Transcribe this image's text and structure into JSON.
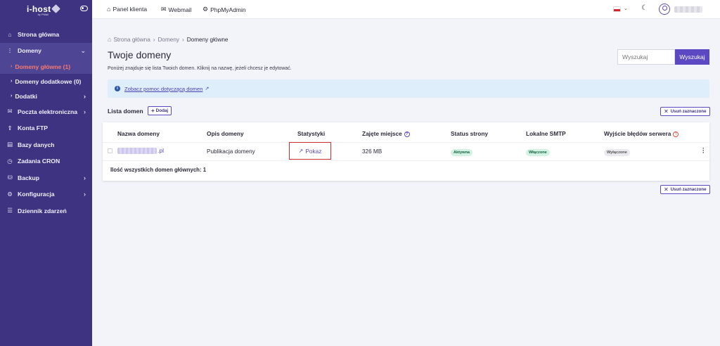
{
  "logo": {
    "name": "i-host",
    "tagline": "by PMail"
  },
  "sidebar": {
    "items": [
      {
        "label": "Strona główna",
        "icon": "home-icon"
      },
      {
        "label": "Domeny",
        "icon": "bar-chart-icon"
      },
      {
        "label": "Domeny główne (1)"
      },
      {
        "label": "Domeny dodatkowe (0)"
      },
      {
        "label": "Dodatki"
      },
      {
        "label": "Poczta elektroniczna",
        "icon": "mail-icon"
      },
      {
        "label": "Konta FTP",
        "icon": "upload-icon"
      },
      {
        "label": "Bazy danych",
        "icon": "database-icon"
      },
      {
        "label": "Zadania CRON",
        "icon": "clock-icon"
      },
      {
        "label": "Backup",
        "icon": "backup-icon"
      },
      {
        "label": "Konfiguracja",
        "icon": "gear-icon"
      },
      {
        "label": "Dziennik zdarzeń",
        "icon": "list-icon"
      }
    ]
  },
  "topbar": {
    "links": [
      {
        "label": "Panel klienta",
        "icon": "home-icon"
      },
      {
        "label": "Webmail",
        "icon": "mail-icon"
      },
      {
        "label": "PhpMyAdmin",
        "icon": "gear-icon"
      }
    ],
    "language_flag": "pl-flag-icon"
  },
  "breadcrumb": {
    "items": [
      "Strona główna",
      "Domeny",
      "Domeny główne"
    ]
  },
  "page": {
    "title": "Twoje domeny",
    "description": "Poniżej znajduje się lista Twoich domen. Kliknij na nazwę, jeżeli chcesz je edytować."
  },
  "search": {
    "placeholder": "Wyszukaj",
    "button_label": "Wyszukaj"
  },
  "info": {
    "link_text": "Zobacz pomoc dotyczącą domen"
  },
  "list": {
    "title": "Lista domen",
    "add_label": "Dodaj",
    "remove_label": "Usuń zaznaczone",
    "headers": [
      "Nazwa domeny",
      "Opis domeny",
      "Statystyki",
      "Zajęte miejsce",
      "Status strony",
      "Lokalne SMTP",
      "Wyjście błędów serwera"
    ],
    "rows": [
      {
        "domain_suffix": ".pl",
        "description": "Publikacja domeny",
        "stats": "Pokaz",
        "space": "326 MB",
        "status": "Aktywna",
        "smtp": "Włączone",
        "errors": "Wyłączone"
      }
    ],
    "total": "Ilość wszystkich domen głównych: 1"
  },
  "colors": {
    "sidebar": "#3d3381",
    "accent": "#5b48c2",
    "active_item": "#f77a70"
  }
}
